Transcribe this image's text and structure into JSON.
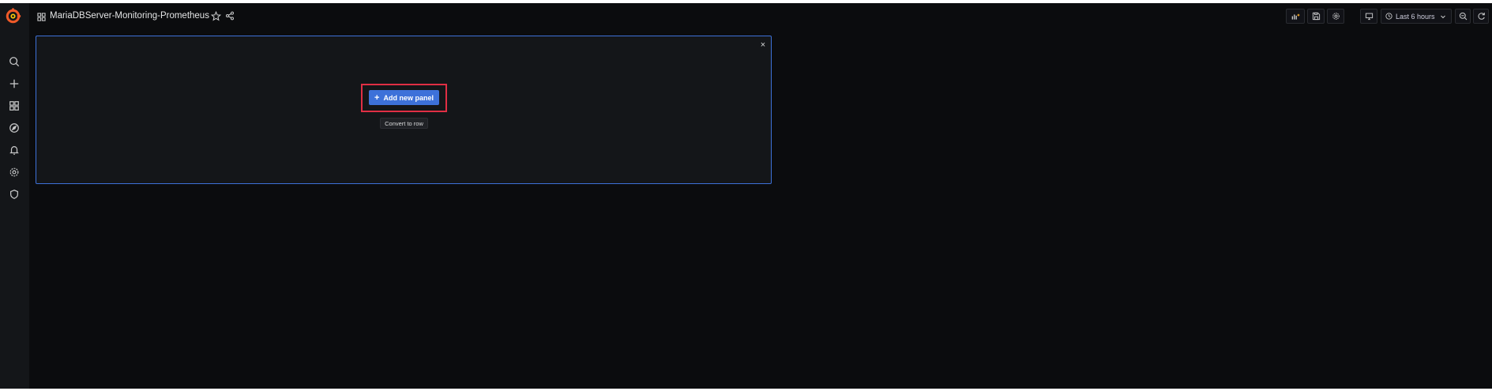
{
  "app": {
    "brand_color": "#f05a28",
    "accent_color": "#3d71d9",
    "highlight_color": "#e02f44"
  },
  "sidemenu": {
    "logo": "grafana-logo-icon",
    "items": [
      {
        "icon": "search-icon"
      },
      {
        "icon": "plus-icon"
      },
      {
        "icon": "dashboards-icon"
      },
      {
        "icon": "explore-compass-icon"
      },
      {
        "icon": "alerting-bell-icon"
      },
      {
        "icon": "configuration-gear-icon"
      },
      {
        "icon": "server-admin-shield-icon"
      }
    ]
  },
  "navbar": {
    "dashboard_title": "MariaDBServer-Monitoring-Prometheus",
    "time_range": "Last 6 hours"
  },
  "add_panel": {
    "add_button_label": "Add new panel",
    "add_button_plus": "+",
    "convert_button_label": "Convert to row",
    "close_glyph": "×"
  }
}
